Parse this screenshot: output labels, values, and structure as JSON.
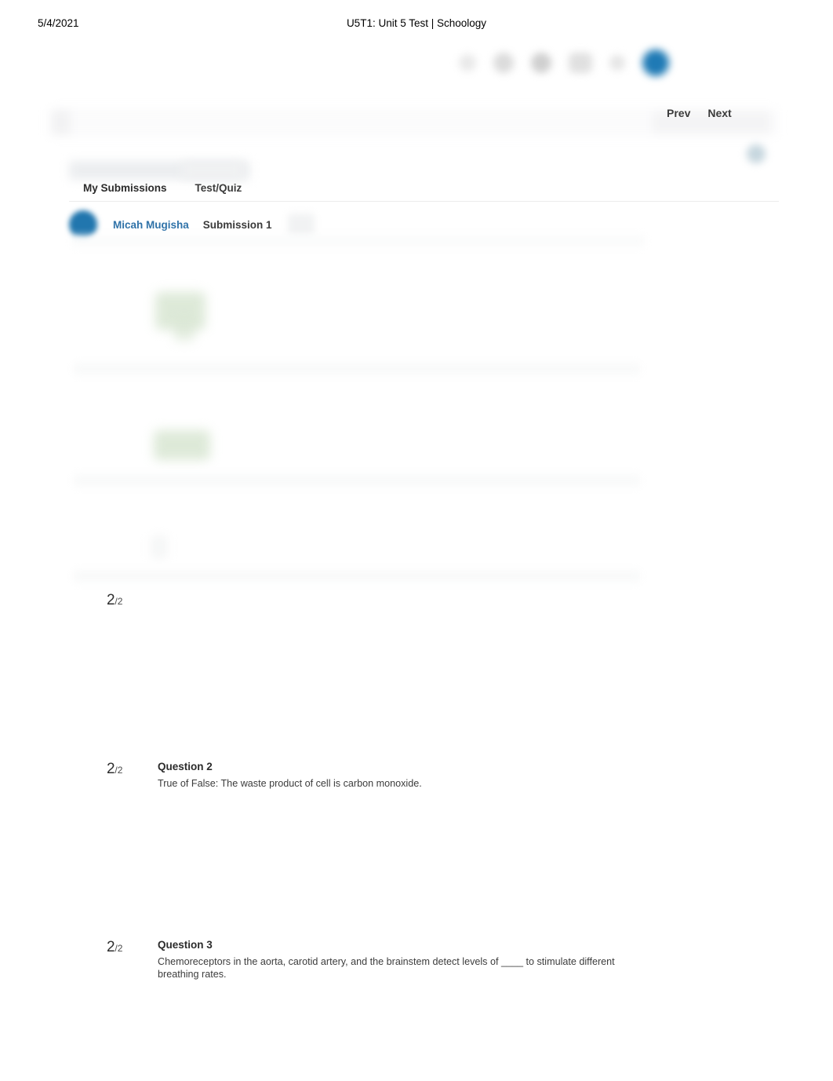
{
  "print_header": {
    "date": "5/4/2021",
    "title": "U5T1: Unit 5 Test | Schoology"
  },
  "toolbar": {
    "icons": [
      {
        "name": "search-icon"
      },
      {
        "name": "courses-icon"
      },
      {
        "name": "groups-icon"
      },
      {
        "name": "resources-icon"
      },
      {
        "name": "notifications-icon"
      },
      {
        "name": "user-avatar-icon"
      }
    ]
  },
  "pagenav": {
    "prev_label": "Prev",
    "next_label": "Next"
  },
  "tabs": [
    {
      "label": "My Submissions",
      "active": true
    },
    {
      "label": "Test/Quiz",
      "active": false
    }
  ],
  "submission": {
    "student_name": "Micah Mugisha",
    "submission_label": "Submission 1"
  },
  "questions": [
    {
      "score_value": "2",
      "score_denominator": "/2",
      "title": "",
      "text": ""
    },
    {
      "score_value": "2",
      "score_denominator": "/2",
      "title": "Question 2",
      "text": "True of False: The waste product of cell is carbon monoxide."
    },
    {
      "score_value": "2",
      "score_denominator": "/2",
      "title": "Question 3",
      "text": "Chemoreceptors in the aorta, carotid artery, and the brainstem detect levels of ____ to stimulate different breathing rates."
    }
  ],
  "colors": {
    "link_blue": "#2f72a8",
    "avatar_blue": "#2176ae",
    "correct_green": "#d8e6d2",
    "text_dark": "#2b2b2b"
  }
}
